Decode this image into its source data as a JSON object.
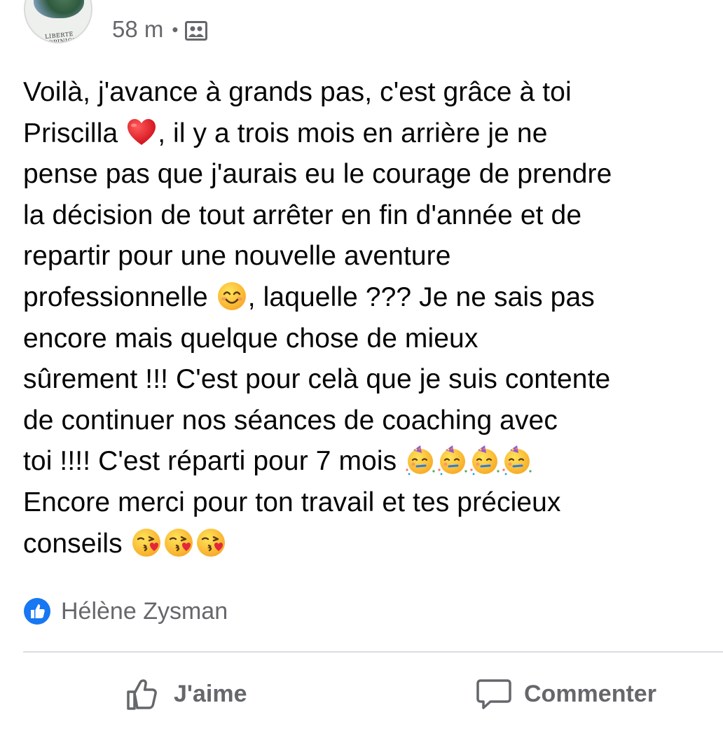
{
  "post": {
    "time": "58 m",
    "separator": "•",
    "audience_icon": "group-icon",
    "avatar_caption": "LIBERTE D'OPINION",
    "lines": [
      {
        "text": "Voilà, j'avance à grands pas, c'est grâce à toi"
      },
      {
        "before": "Priscilla ",
        "emoji": "heart",
        "after": ", il y a trois mois en arrière je ne"
      },
      {
        "text": "pense pas que j'aurais eu le courage de prendre"
      },
      {
        "text": "la décision de tout arrêter en fin d'année et de"
      },
      {
        "text": "repartir pour une nouvelle aventure"
      },
      {
        "before": "professionnelle ",
        "emoji": "smile",
        "after": ", laquelle ??? Je ne sais pas"
      },
      {
        "text": "encore mais quelque chose de mieux"
      },
      {
        "text": "sûrement !!! C'est pour celà que je suis contente"
      },
      {
        "text": "de continuer nos séances de coaching avec"
      },
      {
        "before": "toi !!!! C'est réparti pour 7 mois ",
        "emoji": "party",
        "emoji_count": 4
      },
      {
        "text": "Encore merci pour ton travail et tes précieux"
      },
      {
        "before": "conseils ",
        "emoji": "kiss",
        "emoji_count": 3
      }
    ]
  },
  "reactions": {
    "icon": "like-badge-icon",
    "liked_by": "Hélène Zysman"
  },
  "actions": {
    "like_label": "J'aime",
    "comment_label": "Commenter"
  },
  "colors": {
    "text": "#050505",
    "secondary": "#65676b",
    "like_blue": "#1877f2",
    "divider": "#dadde1"
  }
}
